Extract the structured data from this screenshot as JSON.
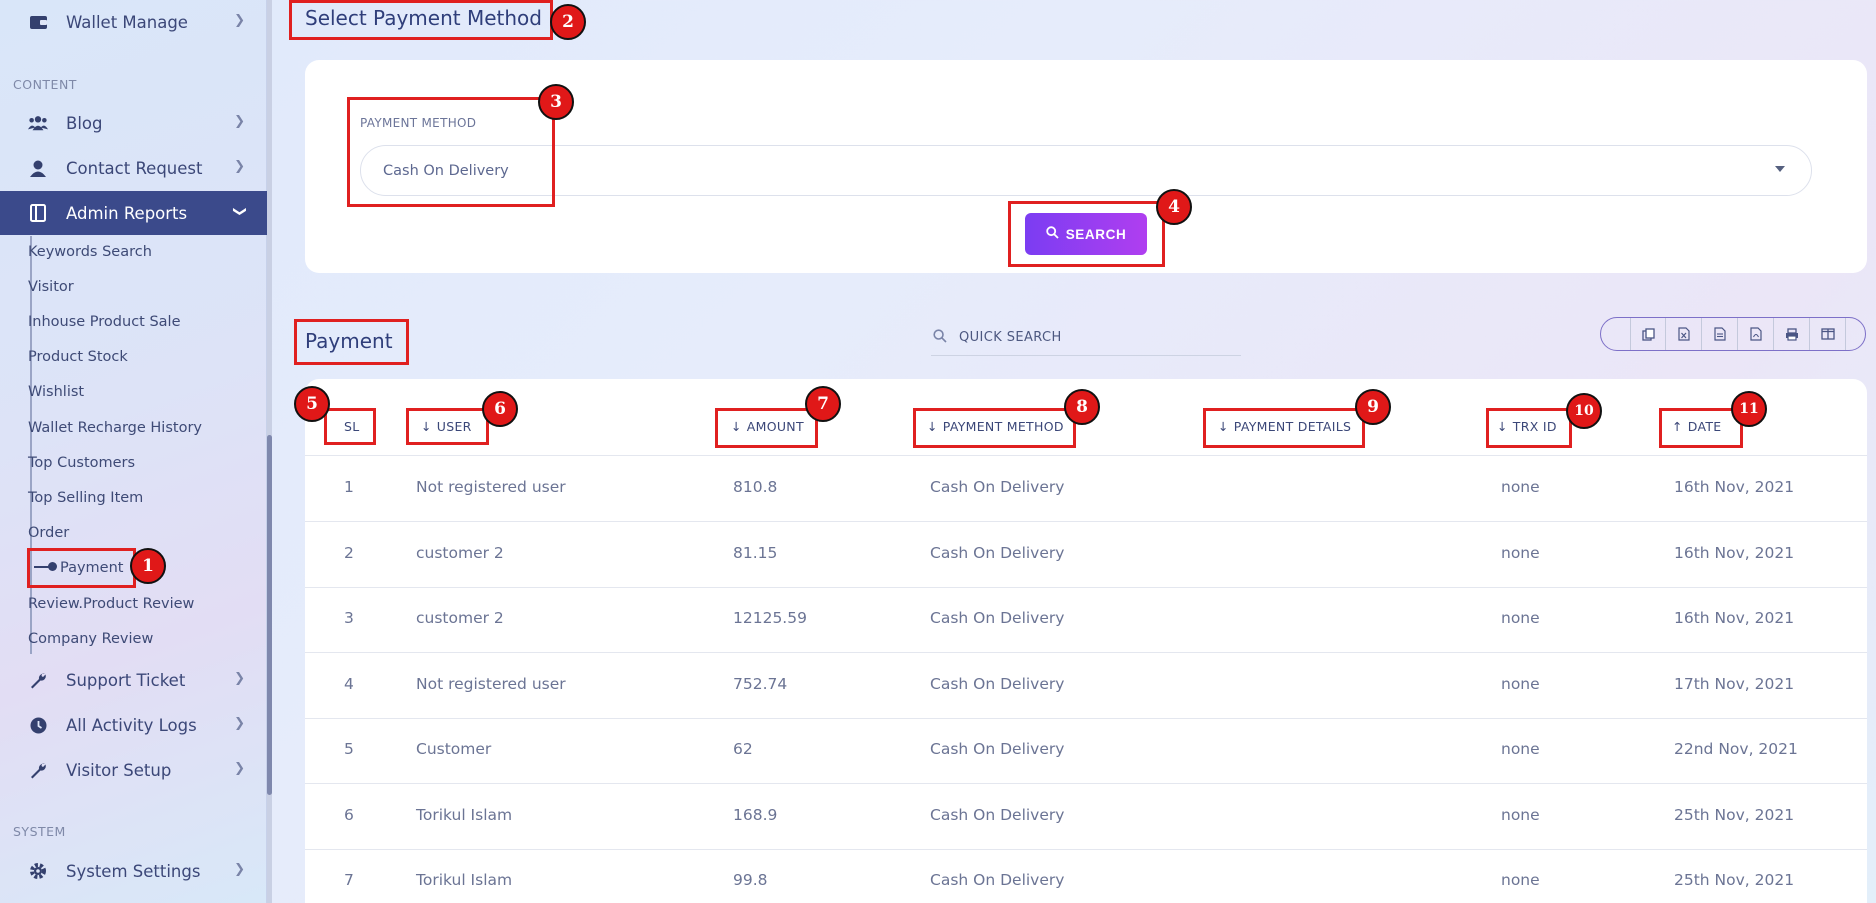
{
  "sidebar": {
    "items_top": [
      {
        "label": "Wallet Manage",
        "icon": "wallet-icon"
      }
    ],
    "content_section": "CONTENT",
    "items_content": [
      {
        "label": "Blog",
        "icon": "users-icon"
      },
      {
        "label": "Contact Request",
        "icon": "user-icon"
      },
      {
        "label": "Admin Reports",
        "icon": "report-icon"
      }
    ],
    "admin_reports_sub": [
      "Keywords Search",
      "Visitor",
      "Inhouse Product Sale",
      "Product Stock",
      "Wishlist",
      "Wallet Recharge History",
      "Top Customers",
      "Top Selling Item",
      "Order",
      "Payment",
      "Review.Product Review",
      "Company Review"
    ],
    "items_after": [
      {
        "label": "Support Ticket",
        "icon": "wrench-icon"
      },
      {
        "label": "All Activity Logs",
        "icon": "clock-icon"
      },
      {
        "label": "Visitor Setup",
        "icon": "wrench-icon"
      }
    ],
    "system_section": "SYSTEM",
    "items_system": [
      {
        "label": "System Settings",
        "icon": "gear-icon"
      }
    ]
  },
  "page_title": "Select Payment Method",
  "filter": {
    "label": "PAYMENT METHOD",
    "selected": "Cash On Delivery",
    "search_button": "SEARCH"
  },
  "section_title": "Payment",
  "quick_search": "QUICK SEARCH",
  "toolbar": [
    "copy-icon",
    "excel-icon",
    "csv-icon",
    "pdf-icon",
    "print-icon",
    "columns-icon"
  ],
  "table": {
    "headers": [
      "SL",
      "USER",
      "AMOUNT",
      "PAYMENT METHOD",
      "PAYMENT DETAILS",
      "TRX ID",
      "DATE"
    ],
    "rows": [
      [
        "1",
        "Not registered user",
        "810.8",
        "Cash On Delivery",
        "",
        "none",
        "16th Nov, 2021"
      ],
      [
        "2",
        "customer 2",
        "81.15",
        "Cash On Delivery",
        "",
        "none",
        "16th Nov, 2021"
      ],
      [
        "3",
        "customer 2",
        "12125.59",
        "Cash On Delivery",
        "",
        "none",
        "16th Nov, 2021"
      ],
      [
        "4",
        "Not registered user",
        "752.74",
        "Cash On Delivery",
        "",
        "none",
        "17th Nov, 2021"
      ],
      [
        "5",
        "Customer",
        "62",
        "Cash On Delivery",
        "",
        "none",
        "22nd Nov, 2021"
      ],
      [
        "6",
        "Torikul Islam",
        "168.9",
        "Cash On Delivery",
        "",
        "none",
        "25th Nov, 2021"
      ],
      [
        "7",
        "Torikul Islam",
        "99.8",
        "Cash On Delivery",
        "",
        "none",
        "25th Nov, 2021"
      ]
    ]
  },
  "badges": [
    "1",
    "2",
    "3",
    "4",
    "5",
    "6",
    "7",
    "8",
    "9",
    "10",
    "11"
  ],
  "colors": {
    "accent": "#3b4a8b",
    "button": "#9b3df0",
    "callout": "#e02020"
  }
}
